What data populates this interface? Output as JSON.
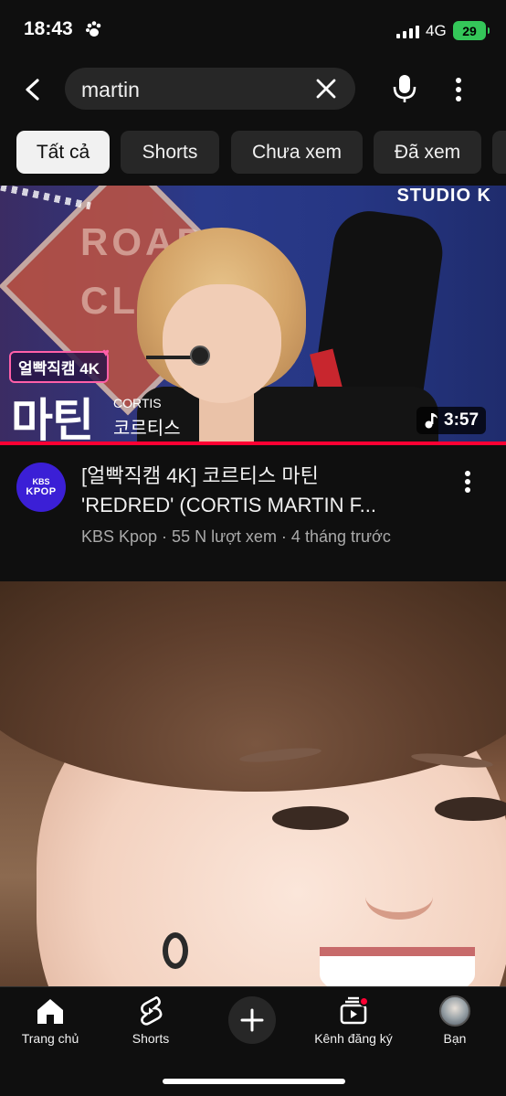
{
  "status_bar": {
    "time": "18:43",
    "network": "4G",
    "battery": "29"
  },
  "search": {
    "query": "martin"
  },
  "chips": [
    {
      "label": "Tất cả",
      "active": true
    },
    {
      "label": "Shorts",
      "active": false
    },
    {
      "label": "Chưa xem",
      "active": false
    },
    {
      "label": "Đã xem",
      "active": false
    }
  ],
  "video1": {
    "thumbnail": {
      "badge": "얼빡직캠 4K",
      "name_ko": "마틴",
      "group_en": "CORTIS",
      "group_ko": "코르티스",
      "studio": "STUDIO K",
      "sign_text": "ROAD CLO",
      "duration": "3:57",
      "watched_fraction": 1.0
    },
    "channel_avatar": {
      "line1": "KBS",
      "line2": "KPOP"
    },
    "title_line1": "[얼빡직캠 4K] 코르티스 마틴",
    "title_line2": "'REDRED' (CORTIS MARTIN F...",
    "subtitle": "KBS Kpop · 55 N lượt xem · 4 tháng trước"
  },
  "bottom_nav": {
    "home": "Trang chủ",
    "shorts": "Shorts",
    "subscriptions": "Kênh đăng ký",
    "you": "Bạn"
  },
  "colors": {
    "accent": "#ff0033",
    "background": "#0f0f0f",
    "chip": "#272727",
    "kbs": "#3b1fd6"
  }
}
